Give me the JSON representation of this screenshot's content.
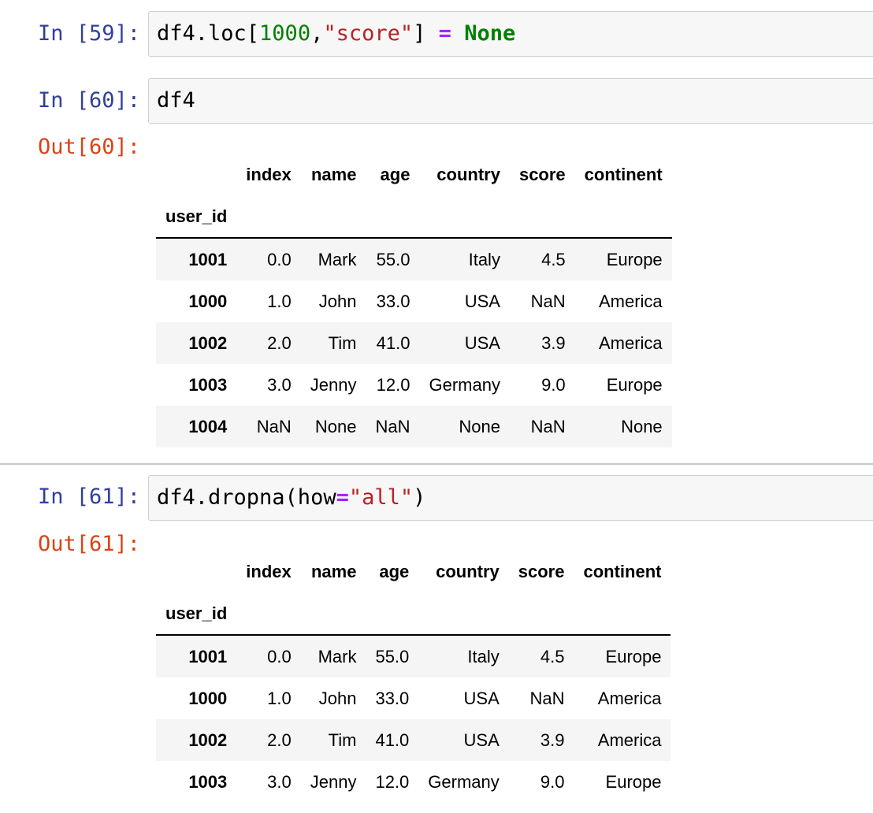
{
  "cells": [
    {
      "prompt": "In [59]:",
      "code": [
        {
          "t": "plain",
          "v": "df4.loc["
        },
        {
          "t": "num",
          "v": "1000"
        },
        {
          "t": "plain",
          "v": ","
        },
        {
          "t": "str",
          "v": "\"score\""
        },
        {
          "t": "plain",
          "v": "] "
        },
        {
          "t": "op",
          "v": "="
        },
        {
          "t": "plain",
          "v": " "
        },
        {
          "t": "kw",
          "v": "None"
        }
      ]
    },
    {
      "prompt": "In [60]:",
      "code": [
        {
          "t": "plain",
          "v": "df4"
        }
      ],
      "out_prompt": "Out[60]:",
      "table": {
        "columns": [
          "index",
          "name",
          "age",
          "country",
          "score",
          "continent"
        ],
        "index_name": "user_id",
        "rows": [
          {
            "id": "1001",
            "values": [
              "0.0",
              "Mark",
              "55.0",
              "Italy",
              "4.5",
              "Europe"
            ]
          },
          {
            "id": "1000",
            "values": [
              "1.0",
              "John",
              "33.0",
              "USA",
              "NaN",
              "America"
            ]
          },
          {
            "id": "1002",
            "values": [
              "2.0",
              "Tim",
              "41.0",
              "USA",
              "3.9",
              "America"
            ]
          },
          {
            "id": "1003",
            "values": [
              "3.0",
              "Jenny",
              "12.0",
              "Germany",
              "9.0",
              "Europe"
            ]
          },
          {
            "id": "1004",
            "values": [
              "NaN",
              "None",
              "NaN",
              "None",
              "NaN",
              "None"
            ]
          }
        ]
      }
    },
    {
      "prompt": "In [61]:",
      "code": [
        {
          "t": "plain",
          "v": "df4.dropna(how"
        },
        {
          "t": "op",
          "v": "="
        },
        {
          "t": "str",
          "v": "\"all\""
        },
        {
          "t": "plain",
          "v": ")"
        }
      ],
      "out_prompt": "Out[61]:",
      "table": {
        "columns": [
          "index",
          "name",
          "age",
          "country",
          "score",
          "continent"
        ],
        "index_name": "user_id",
        "rows": [
          {
            "id": "1001",
            "values": [
              "0.0",
              "Mark",
              "55.0",
              "Italy",
              "4.5",
              "Europe"
            ]
          },
          {
            "id": "1000",
            "values": [
              "1.0",
              "John",
              "33.0",
              "USA",
              "NaN",
              "America"
            ]
          },
          {
            "id": "1002",
            "values": [
              "2.0",
              "Tim",
              "41.0",
              "USA",
              "3.9",
              "America"
            ]
          },
          {
            "id": "1003",
            "values": [
              "3.0",
              "Jenny",
              "12.0",
              "Germany",
              "9.0",
              "Europe"
            ]
          }
        ]
      }
    }
  ]
}
